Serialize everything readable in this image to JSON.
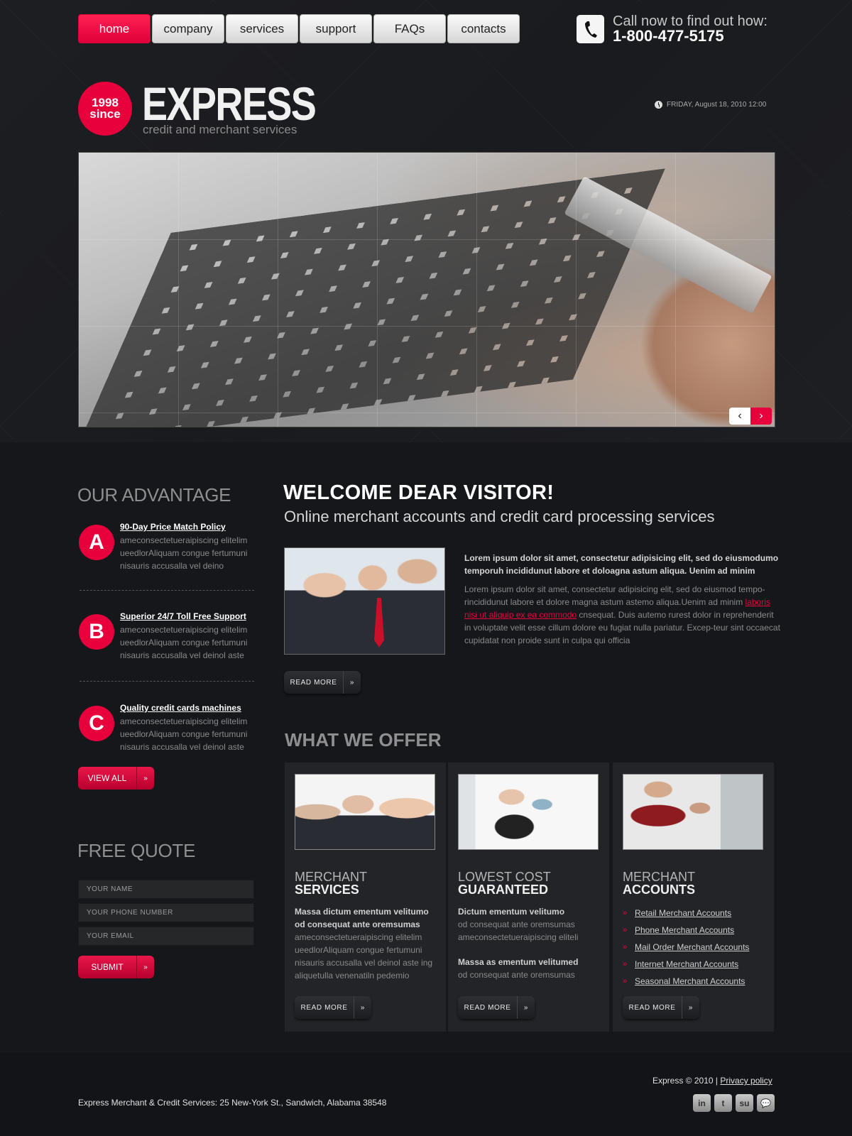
{
  "nav": {
    "items": [
      {
        "label": "home",
        "active": true
      },
      {
        "label": "company",
        "active": false
      },
      {
        "label": "services",
        "active": false
      },
      {
        "label": "support",
        "active": false
      },
      {
        "label": "FAQs",
        "active": false
      },
      {
        "label": "contacts",
        "active": false
      }
    ]
  },
  "phone": {
    "icon": "phone-icon",
    "tagline": "Call now to find out how:",
    "number": "1-800-477-5175"
  },
  "logo": {
    "badge_year": "1998",
    "badge_since": "since",
    "title": "EXPRESS",
    "subtitle": "credit and merchant services"
  },
  "date": {
    "icon": "clock-icon",
    "text": "FRIDAY, August 18, 2010 12:00"
  },
  "slider": {
    "prev_icon": "chevron-left-icon",
    "next_icon": "chevron-right-icon",
    "prev_glyph": "‹",
    "next_glyph": "›"
  },
  "advantage": {
    "heading": "OUR ADVANTAGE",
    "items": [
      {
        "badge": "A",
        "title": "90-Day Price Match Policy",
        "text": "ameconsectetueraipiscing elitelim ueedlorAliquam congue fertumuni nisauris accusalla vel deino"
      },
      {
        "badge": "B",
        "title": "Superior 24/7 Toll Free Support",
        "text": "ameconsectetueraipiscing elitelim ueedlorAliquam congue fertumuni nisauris accusalla vel deinol aste"
      },
      {
        "badge": "C",
        "title": "Quality credit cards machines",
        "text": "ameconsectetueraipiscing elitelim ueedlorAliquam congue fertumuni nisauris accusalla vel deinol aste"
      }
    ],
    "view_all_label": "VIEW ALL",
    "arrow_glyph": "»"
  },
  "quote": {
    "heading": "FREE QUOTE",
    "name_placeholder": "YOUR NAME",
    "phone_placeholder": "YOUR PHONE NUMBER",
    "email_placeholder": "YOUR EMAIL",
    "submit_label": "SUBMIT"
  },
  "welcome": {
    "title": "WELCOME DEAR VISITOR!",
    "subtitle": "Online merchant accounts and credit card processing services",
    "bold_text": "Lorem ipsum dolor sit amet, consectetur adipisicing elit, sed do eiusmodumo temporuh incididunut labore et doloagna astum aliqua. Uenim ad minim",
    "text_before_link": "Lorem ipsum dolor sit amet, consectetur adipisicing elit, sed do eiusmod tempo-rincididunut labore et dolore magna astum astemo aliqua.Uenim ad minim ",
    "link_text": "laboris nisi ut aliquip ex ea commodo",
    "text_after_link": " cnsequat. Duis autemo rurest dolor in reprehenderit in voluptate velit esse cillum dolore eu fugiat nulla pariatur. Excep-teur sint occaecat cupidatat non proide sunt in culpa qui officia",
    "read_more_label": "READ MORE"
  },
  "offer": {
    "heading": "WHAT WE OFFER",
    "cards": [
      {
        "title_line1": "MERCHANT",
        "title_line2": "SERVICES",
        "bold1": "Massa dictum ementum velitumo od consequat ante oremsumas",
        "text1": "ameconsectetueraipiscing elitelim ueedlorAliquam congue fertumuni nisauris accusalla vel deinol aste ing aliquetulla venenatiln pedemio",
        "read_more_label": "READ MORE"
      },
      {
        "title_line1": "LOWEST COST",
        "title_line2": "GUARANTEED",
        "bold1": "Dictum ementum velitumo",
        "text1": "od consequat ante oremsumas ameconsectetueraipiscing eliteli",
        "bold2": "Massa as ementum velitumed",
        "text2": "od consequat ante oremsumas",
        "read_more_label": "READ MORE"
      },
      {
        "title_line1": "MERCHANT",
        "title_line2": "ACCOUNTS",
        "links": [
          "Retail Merchant Accounts",
          "Phone Merchant Accounts",
          "Mail Order Merchant Accounts",
          "Internet Merchant Accounts",
          "Seasonal Merchant Accounts"
        ],
        "read_more_label": "READ MORE"
      }
    ]
  },
  "footer": {
    "copyright": "Express © 2010 |",
    "privacy_label": "Privacy policy",
    "address": "Express Merchant & Credit Services: 25 New-York St., Sandwich, Alabama 38548",
    "social": [
      {
        "icon": "linkedin-icon",
        "glyph": "in"
      },
      {
        "icon": "twitter-icon",
        "glyph": "t"
      },
      {
        "icon": "stumbleupon-icon",
        "glyph": "su"
      },
      {
        "icon": "chat-icon",
        "glyph": "💬"
      }
    ]
  },
  "colors": {
    "accent": "#e8003d",
    "background": "#16171b",
    "card": "#232427"
  }
}
